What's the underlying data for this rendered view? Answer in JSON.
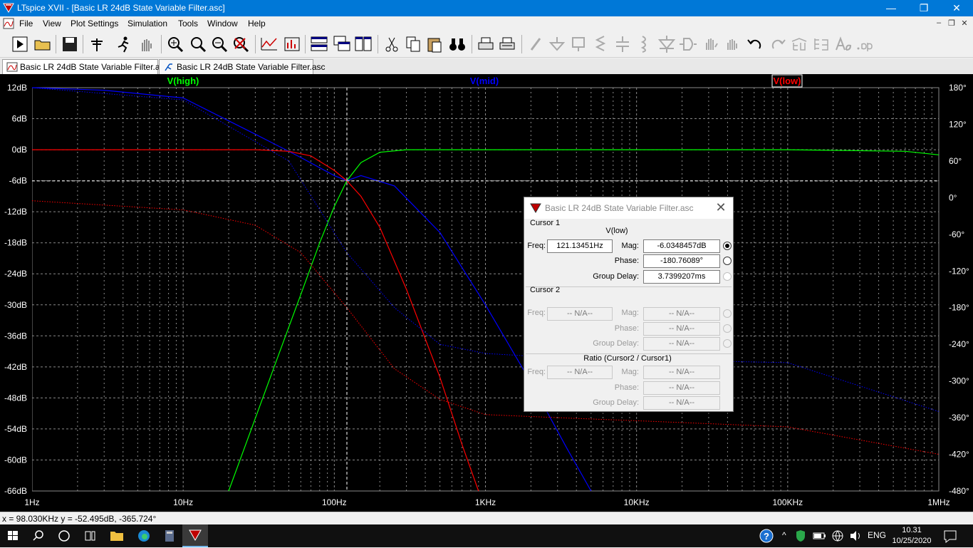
{
  "window": {
    "title": "LTspice XVII - [Basic LR 24dB State Variable Filter.asc]"
  },
  "menu": {
    "items": [
      "File",
      "View",
      "Plot Settings",
      "Simulation",
      "Tools",
      "Window",
      "Help"
    ]
  },
  "tabs": [
    {
      "label": "Basic LR 24dB State Variable Filter.asc",
      "icon": "waveform-icon",
      "active": true
    },
    {
      "label": "Basic LR 24dB State Variable Filter.asc",
      "icon": "schematic-icon",
      "active": false
    }
  ],
  "plot": {
    "traces": [
      {
        "name": "V(high)",
        "color": "#00ff00"
      },
      {
        "name": "V(mid)",
        "color": "#0000ff"
      },
      {
        "name": "V(low)",
        "color": "#ff0000"
      }
    ],
    "y_left_ticks": [
      "12dB",
      "6dB",
      "0dB",
      "-6dB",
      "-12dB",
      "-18dB",
      "-24dB",
      "-30dB",
      "-36dB",
      "-42dB",
      "-48dB",
      "-54dB",
      "-60dB",
      "-66dB"
    ],
    "y_right_ticks": [
      "180°",
      "120°",
      "60°",
      "0°",
      "-60°",
      "-120°",
      "-180°",
      "-240°",
      "-300°",
      "-360°",
      "-420°",
      "-480°"
    ],
    "x_ticks": [
      "1Hz",
      "10Hz",
      "100Hz",
      "1KHz",
      "10KHz",
      "100KHz",
      "1MHz"
    ]
  },
  "chart_data": {
    "type": "line",
    "x_scale": "log",
    "xlim": [
      1,
      1000000
    ],
    "ylim": [
      -66,
      12
    ],
    "y2lim": [
      -480,
      180
    ],
    "grid": true,
    "cursor": {
      "x": 121.13451,
      "y": -6.0348457
    },
    "series": [
      {
        "name": "V(high)",
        "axis": "magnitude",
        "x": [
          20,
          40,
          60,
          80,
          100,
          121,
          150,
          200,
          300,
          1000,
          100000,
          600000,
          1000000
        ],
        "y": [
          -66,
          -42,
          -28,
          -18,
          -11,
          -6,
          -2.5,
          -0.5,
          0,
          0,
          0,
          -0.3,
          -1
        ]
      },
      {
        "name": "V(mid)",
        "axis": "magnitude",
        "x": [
          1,
          3,
          10,
          30,
          60,
          100,
          121,
          150,
          250,
          500,
          1000,
          2000,
          3500,
          5000
        ],
        "y": [
          12,
          11.5,
          10,
          3,
          -1.5,
          -5,
          -6,
          -5,
          -7,
          -16,
          -30,
          -45,
          -58,
          -66
        ]
      },
      {
        "name": "V(low)",
        "axis": "magnitude",
        "x": [
          1,
          10,
          30,
          50,
          70,
          100,
          121,
          150,
          200,
          300,
          500,
          700,
          900
        ],
        "y": [
          0,
          0,
          0,
          -0.3,
          -1.2,
          -4,
          -6,
          -9,
          -15,
          -27,
          -44,
          -57,
          -66
        ]
      },
      {
        "name": "V(mid) phase",
        "axis": "phase",
        "x": [
          1,
          10,
          50,
          121,
          250,
          500,
          1000,
          3000,
          10000,
          100000,
          1000000
        ],
        "y": [
          180,
          160,
          60,
          -90,
          -180,
          -240,
          -255,
          -262,
          -265,
          -270,
          -350
        ]
      },
      {
        "name": "V(low) phase",
        "axis": "phase",
        "x": [
          1,
          10,
          30,
          60,
          121,
          250,
          500,
          1000,
          3000,
          10000,
          100000,
          1000000
        ],
        "y": [
          -5,
          -20,
          -45,
          -90,
          -180,
          -280,
          -330,
          -355,
          -360,
          -365,
          -375,
          -420
        ]
      }
    ]
  },
  "dialog": {
    "title": "Basic LR 24dB State Variable Filter.asc",
    "cursor1_label": "Cursor 1",
    "cursor1_trace": "V(low)",
    "freq_label": "Freq:",
    "mag_label": "Mag:",
    "phase_label": "Phase:",
    "group_delay_label": "Group Delay:",
    "c1_freq": "121.13451Hz",
    "c1_mag": "-6.0348457dB",
    "c1_phase": "-180.76089°",
    "c1_group_delay": "3.7399207ms",
    "cursor2_label": "Cursor 2",
    "na": "-- N/A--",
    "ratio_label": "Ratio (Cursor2 / Cursor1)"
  },
  "status": {
    "text": "x = 98.030KHz   y = -52.495dB, -365.724°"
  },
  "taskbar": {
    "language": "ENG",
    "time": "10.31",
    "date": "10/25/2020"
  }
}
